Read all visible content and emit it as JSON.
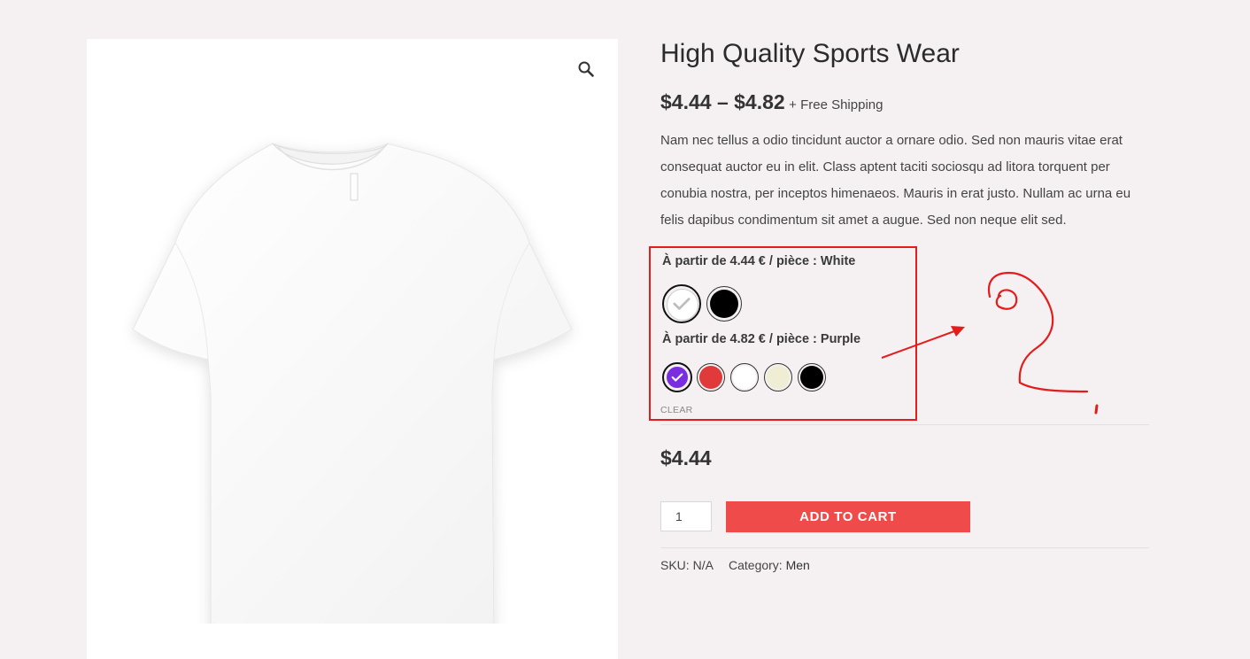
{
  "product": {
    "title": "High Quality Sports Wear",
    "price_range": "$4.44 – $4.82",
    "shipping_note": "+ Free Shipping",
    "description": "Nam nec tellus a odio tincidunt auctor a ornare odio. Sed non mauris vitae erat consequat auctor eu in elit. Class aptent taciti sociosqu ad litora torquent per conubia nostra, per inceptos himenaeos. Mauris in erat justo. Nullam ac urna eu felis dapibus condimentum sit amet a augue. Sed non neque elit sed.",
    "image_icon": "zoom-icon"
  },
  "variations": {
    "attribute_1": {
      "label": "À partir de 4.44 € / pièce : White",
      "options": [
        {
          "name": "White",
          "color": "#ffffff",
          "selected": true
        },
        {
          "name": "Black",
          "color": "#000000",
          "selected": false
        }
      ]
    },
    "attribute_2": {
      "label": "À partir de 4.82 € / pièce : Purple",
      "options": [
        {
          "name": "Purple",
          "color": "#7b2ee0",
          "selected": true
        },
        {
          "name": "Red",
          "color": "#e03a3a",
          "selected": false
        },
        {
          "name": "White",
          "color": "#ffffff",
          "selected": false
        },
        {
          "name": "Cream",
          "color": "#efedd3",
          "selected": false
        },
        {
          "name": "Black",
          "color": "#000000",
          "selected": false
        }
      ]
    },
    "clear_label": "CLEAR"
  },
  "cart": {
    "price": "$4.44",
    "quantity": "1",
    "add_to_cart_label": "ADD TO CART"
  },
  "meta": {
    "sku_label": "SKU:",
    "sku_value": "N/A",
    "category_label": "Category:",
    "category_value": "Men"
  },
  "colors": {
    "background": "#f5f1f2",
    "accent_button": "#f04b4b",
    "annotation_red": "#e51c1c"
  }
}
